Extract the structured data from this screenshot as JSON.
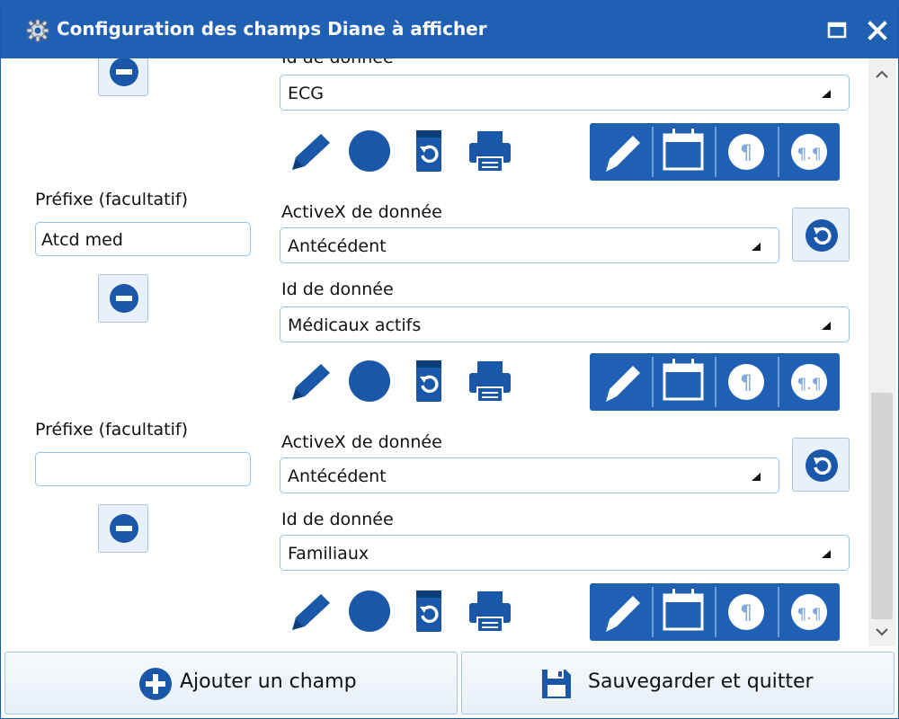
{
  "window": {
    "title": "Configuration des champs Diane à afficher",
    "icons": {
      "app": "gear-icon",
      "maximize": "maximize-icon",
      "close": "close-icon"
    }
  },
  "fields": [
    {
      "prefix_label": "",
      "prefix_value": "",
      "activex_label": "",
      "activex_value": "",
      "id_label": "Id de donnée",
      "id_value": "ECG"
    },
    {
      "prefix_label": "Préfixe (facultatif)",
      "prefix_value": "Atcd med",
      "activex_label": "ActiveX de donnée",
      "activex_value": "Antécédent",
      "id_label": "Id de donnée",
      "id_value": "Médicaux actifs"
    },
    {
      "prefix_label": "Préfixe (facultatif)",
      "prefix_value": "",
      "activex_label": "ActiveX de donnée",
      "activex_value": "Antécédent",
      "id_label": "Id de donnée",
      "id_value": "Familiaux"
    }
  ],
  "footer": {
    "add_label": "Ajouter un champ",
    "save_label": "Sauvegarder et quitter"
  },
  "colors": {
    "titlebar": "#1f60b3",
    "accent": "#1a57a8",
    "border": "#8ec4ef"
  }
}
